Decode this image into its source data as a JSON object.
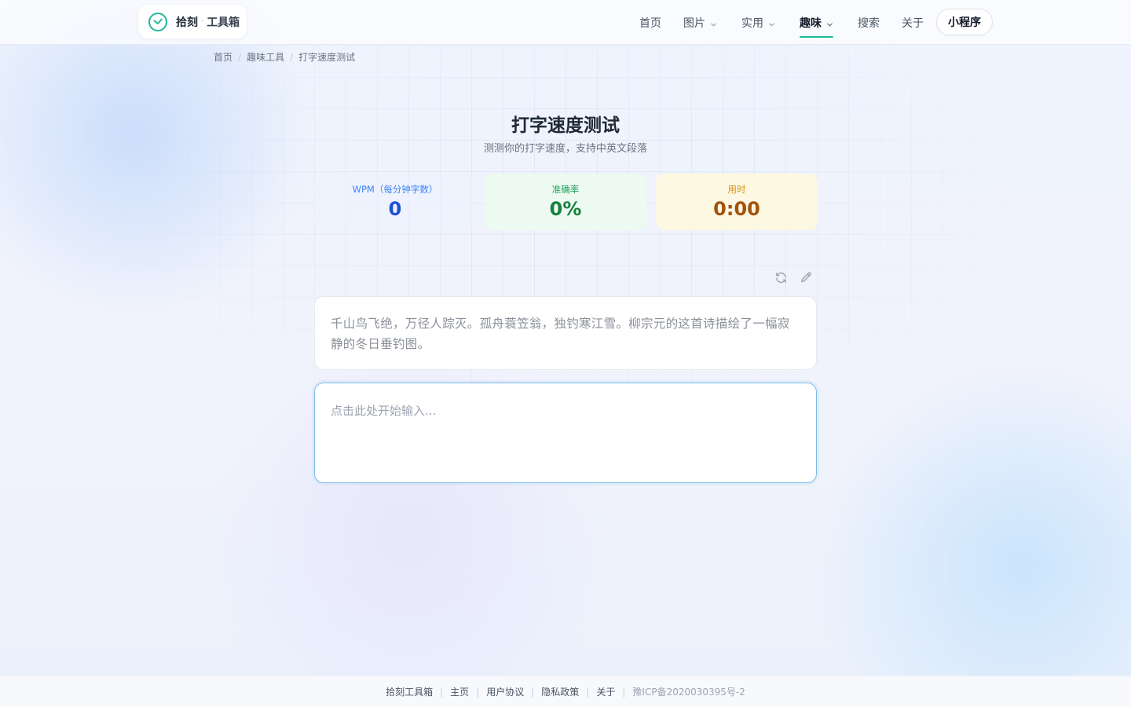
{
  "header": {
    "logo_text": "拾刻",
    "logo_dot": "·",
    "logo_sub": "工具箱",
    "nav": [
      {
        "label": "首页",
        "dropdown": false
      },
      {
        "label": "图片",
        "dropdown": true
      },
      {
        "label": "实用",
        "dropdown": true
      },
      {
        "label": "趣味",
        "dropdown": true,
        "active": true
      },
      {
        "label": "搜索",
        "dropdown": false
      },
      {
        "label": "关于",
        "dropdown": false
      }
    ],
    "mini_program_label": "小程序",
    "accent_color": "#1fb99a"
  },
  "breadcrumb": {
    "items": [
      "首页",
      "趣味工具",
      "打字速度测试"
    ],
    "separator": "/"
  },
  "page": {
    "title": "打字速度测试",
    "subtitle": "测测你的打字速度，支持中英文段落"
  },
  "stats": {
    "wpm": {
      "label": "WPM（每分钟字数）",
      "value": "0",
      "color": "#1d4ed8"
    },
    "accuracy": {
      "label": "准确率",
      "value": "0%",
      "color": "#15803d"
    },
    "time": {
      "label": "用时",
      "value": "0:00",
      "color": "#a2540c"
    }
  },
  "tools": {
    "refresh_icon": "refresh-icon",
    "edit_icon": "pencil-icon"
  },
  "passage": {
    "text": "千山鸟飞绝，万径人踪灭。孤舟蓑笠翁，独钓寒江雪。柳宗元的这首诗描绘了一幅寂静的冬日垂钓图。"
  },
  "input": {
    "placeholder": "点击此处开始输入...",
    "value": ""
  },
  "footer": {
    "links": [
      "拾刻工具箱",
      "主页",
      "用户协议",
      "隐私政策",
      "关于"
    ],
    "icp": "豫ICP备2020030395号-2"
  }
}
